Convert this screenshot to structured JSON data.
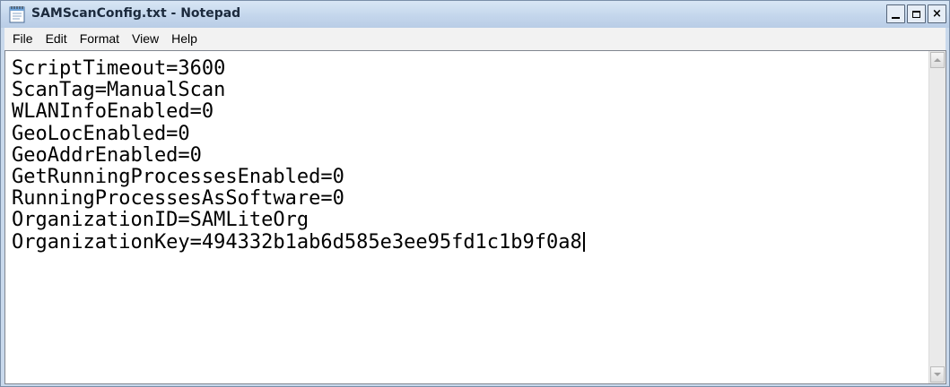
{
  "window": {
    "title": "SAMScanConfig.txt - Notepad",
    "icon": "notepad-icon",
    "controls": {
      "minimize_icon": "minimize-icon",
      "maximize_icon": "maximize-icon",
      "close_label": "×"
    }
  },
  "menu": {
    "items": [
      {
        "label": "File"
      },
      {
        "label": "Edit"
      },
      {
        "label": "Format"
      },
      {
        "label": "View"
      },
      {
        "label": "Help"
      }
    ]
  },
  "editor": {
    "lines": [
      "ScriptTimeout=3600",
      "ScanTag=ManualScan",
      "WLANInfoEnabled=0",
      "GeoLocEnabled=0",
      "GeoAddrEnabled=0",
      "GetRunningProcessesEnabled=0",
      "RunningProcessesAsSoftware=0",
      "OrganizationID=SAMLiteOrg",
      "OrganizationKey=494332b1ab6d585e3ee95fd1c1b9f0a8"
    ]
  },
  "colors": {
    "title_bar": "#c4d6ec",
    "menu_bar": "#f2f2f2",
    "editor_background": "#ffffff",
    "text": "#000000"
  }
}
